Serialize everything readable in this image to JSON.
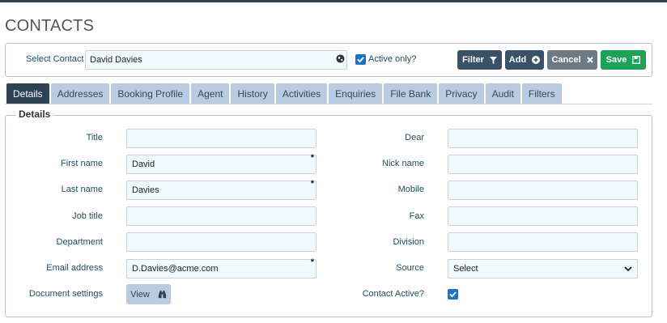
{
  "page": {
    "title": "CONTACTS"
  },
  "select_contact": {
    "label": "Select Contact",
    "value": "David Davies",
    "active_only_label": "Active only?",
    "active_only_checked": true
  },
  "toolbar": {
    "filter_label": "Filter",
    "add_label": "Add",
    "cancel_label": "Cancel",
    "save_label": "Save"
  },
  "tabs": [
    {
      "label": "Details",
      "active": true
    },
    {
      "label": "Addresses"
    },
    {
      "label": "Booking Profile"
    },
    {
      "label": "Agent"
    },
    {
      "label": "History"
    },
    {
      "label": "Activities"
    },
    {
      "label": "Enquiries"
    },
    {
      "label": "File Bank"
    },
    {
      "label": "Privacy"
    },
    {
      "label": "Audit"
    },
    {
      "label": "Filters"
    }
  ],
  "details": {
    "legend": "Details",
    "left_fields": [
      {
        "label": "Title",
        "value": "",
        "required": false
      },
      {
        "label": "First name",
        "value": "David",
        "required": true
      },
      {
        "label": "Last name",
        "value": "Davies",
        "required": true
      },
      {
        "label": "Job title",
        "value": "",
        "required": false
      },
      {
        "label": "Department",
        "value": "",
        "required": false
      },
      {
        "label": "Email address",
        "value": "D.Davies@acme.com",
        "required": true
      }
    ],
    "right_fields": [
      {
        "label": "Dear",
        "value": ""
      },
      {
        "label": "Nick name",
        "value": ""
      },
      {
        "label": "Mobile",
        "value": ""
      },
      {
        "label": "Fax",
        "value": ""
      },
      {
        "label": "Division",
        "value": ""
      }
    ],
    "required_marker": "*",
    "source": {
      "label": "Source",
      "value": "Select"
    },
    "document_settings": {
      "label": "Document settings",
      "button_label": "View"
    },
    "contact_active": {
      "label": "Contact Active?",
      "checked": true
    }
  },
  "colors": {
    "primary_dark": "#2e4255",
    "tab_bg": "#b9cbe0",
    "save_green": "#1aa255",
    "input_bg": "#f0fbfd",
    "label_blue": "#1f4e66"
  }
}
